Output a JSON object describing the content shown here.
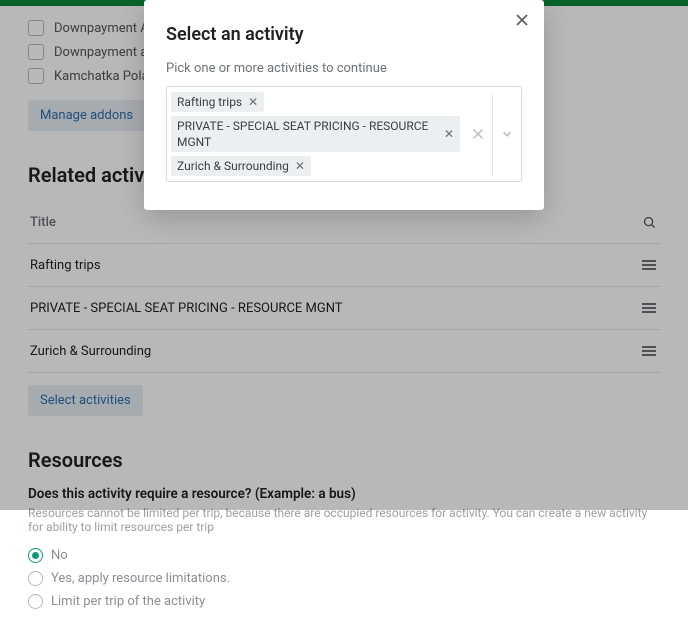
{
  "addons": {
    "items": [
      {
        "label": "Downpayment Add-On"
      },
      {
        "label": "Downpayment add-on for"
      },
      {
        "label": "Kamchatka Polar Bear Saf"
      }
    ],
    "manage_button": "Manage addons"
  },
  "related": {
    "heading": "Related activities",
    "col_title": "Title",
    "rows": [
      {
        "title": "Rafting trips"
      },
      {
        "title": "PRIVATE - SPECIAL SEAT PRICING - RESOURCE MGNT"
      },
      {
        "title": "Zurich & Surrounding"
      }
    ],
    "select_button": "Select activities"
  },
  "resources": {
    "heading": "Resources",
    "question": "Does this activity require a resource? (Example: a bus)",
    "help": "Resources cannot be limited per trip, because there are occupied resources for activity. You can create a new activity for ability to limit resources per trip",
    "options": [
      {
        "label": "No",
        "selected": true
      },
      {
        "label": "Yes, apply resource limitations.",
        "selected": false
      },
      {
        "label": "Limit per trip of the activity",
        "selected": false
      }
    ]
  },
  "modal": {
    "title": "Select an activity",
    "subtitle": "Pick one or more activities to continue",
    "chips": [
      "Rafting trips",
      "PRIVATE - SPECIAL SEAT PRICING - RESOURCE MGNT",
      "Zurich & Surrounding"
    ]
  }
}
